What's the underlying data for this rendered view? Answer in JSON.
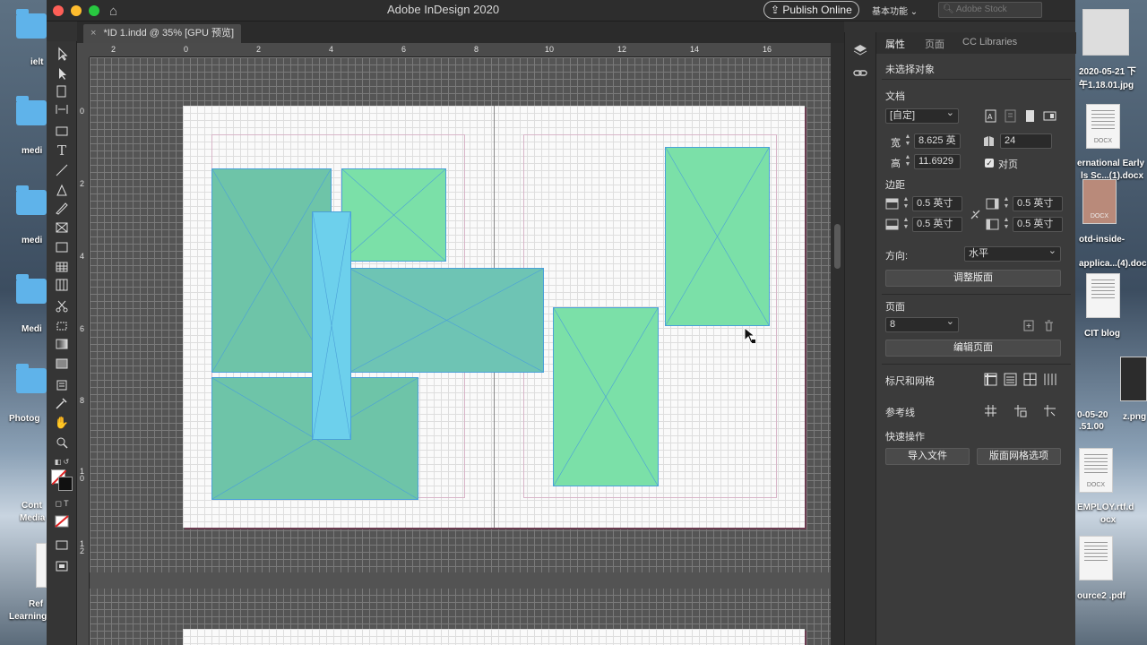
{
  "app": {
    "title": "Adobe InDesign 2020",
    "publish_label": "Publish Online",
    "workspace_label": "基本功能 ⌄",
    "stock_placeholder": "Adobe Stock",
    "home_glyph": "⌂"
  },
  "document_tab": {
    "close_glyph": "×",
    "title": "*ID 1.indd @ 35% [GPU 预览]"
  },
  "rulers": {
    "horizontal": [
      "2",
      "0",
      "2",
      "4",
      "6",
      "8",
      "10",
      "12",
      "14",
      "16"
    ],
    "vertical": [
      "0",
      "2",
      "4",
      "6",
      "8",
      "1 0",
      "1 2"
    ]
  },
  "panel": {
    "tabs": [
      "属性",
      "页面",
      "CC Libraries"
    ],
    "selection_status": "未选择对象",
    "document_section": "文档",
    "preset_value": "[自定]",
    "width_label": "宽",
    "width_value": "8.625 英",
    "height_label": "高",
    "height_value": "11.6929",
    "pages_count": "24",
    "facing_pages_label": "对页",
    "facing_pages_checked": true,
    "margins_section": "边距",
    "margin_top": "0.5 英寸",
    "margin_bottom": "0.5 英寸",
    "margin_inside": "0.5 英寸",
    "margin_outside": "0.5 英寸",
    "orientation_label": "方向:",
    "orientation_value": "水平",
    "adjust_layout_button": "调整版面",
    "pages_section": "页面",
    "current_page": "8",
    "edit_page_button": "编辑页面",
    "rulers_grids_section": "标尺和网格",
    "guides_section": "参考线",
    "quick_actions_section": "快速操作",
    "import_file_button": "导入文件",
    "layout_grid_button": "版面网格选项"
  },
  "desktop_left": [
    {
      "label": "ielt"
    },
    {
      "label": "medi"
    },
    {
      "label": "medi"
    },
    {
      "label": "Medi"
    },
    {
      "label": "Photog"
    },
    {
      "label": "Cont"
    },
    {
      "label": "Media"
    },
    {
      "label": "Ref"
    },
    {
      "label": "Learning"
    }
  ],
  "desktop_right": [
    {
      "label": "2020-05-21 下"
    },
    {
      "label": "午1.18.01.jpg"
    },
    {
      "label": "ernational Early"
    },
    {
      "label": "ls Sc...(1).docx"
    },
    {
      "label": "otd-inside-"
    },
    {
      "label": "applica...(4).doc"
    },
    {
      "label": "CIT blog"
    },
    {
      "label": "z.png"
    },
    {
      "label": "0-05-20"
    },
    {
      "label": ".51.00"
    },
    {
      "label": "EMPLOY.rtf.d"
    },
    {
      "label": "ocx"
    },
    {
      "label": "ource2 .pdf"
    }
  ],
  "colors": {
    "frame_green": "#6ec4a8",
    "frame_mint": "#7be0a8",
    "frame_blue": "#6dd0ec",
    "frame_teal": "#6ec4b4",
    "page_bg": "#fafafa"
  }
}
